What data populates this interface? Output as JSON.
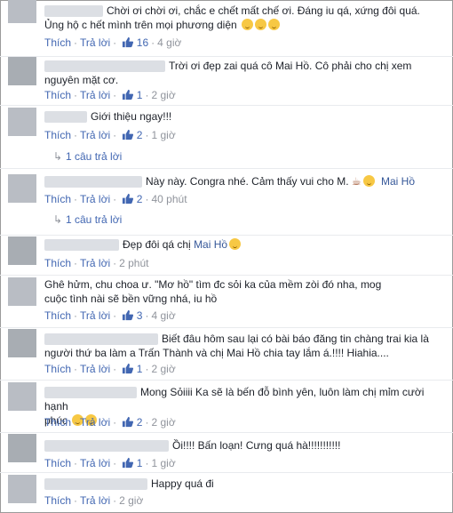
{
  "actions": {
    "like": "Thích",
    "reply": "Trả lời"
  },
  "comments": [
    {
      "line1": "Chời ơi chời ơi, chắc e chết mất chế ơi. Đáng iu qá, xứng đôi quá.",
      "line2": "Ủng hộ c hết mình trên mọi phương diện",
      "likes": "16",
      "time": "4 giờ"
    },
    {
      "line1": "Trời ơi đẹp zai quá cô Mai Hồ. Cô phải cho chị xem",
      "line2": "nguyên mặt cơ.",
      "likes": "1",
      "time": "2 giờ"
    },
    {
      "line1": "Giới thiệu ngay!!!",
      "likes": "2",
      "time": "1 giờ",
      "replies": "1 câu trả lời"
    },
    {
      "line1": "Này này. Congra nhé. Cảm thấy vui cho M.",
      "tag": "Mai Hồ",
      "likes": "2",
      "time": "40 phút",
      "replies": "1 câu trả lời"
    },
    {
      "line1": "Đẹp đôi qá chị",
      "tag": "Mai Hồ",
      "time": "2 phút"
    },
    {
      "line1": "Ghê hửm, chu choa ư. \"Mơ hồ\" tìm đc sỏi ka của mềm zòi đó nha, mog",
      "line2": "cuộc tình nài sẽ bền vững nhá, iu hồ",
      "likes": "3",
      "time": "4 giờ"
    },
    {
      "line1": "Biết đâu hôm sau lại có bài báo đăng tin chàng trai kia là",
      "line2": "người thứ ba làm a Trấn Thành và chị Mai Hồ chia tay lắm á.!!!! Hiahia....",
      "likes": "1",
      "time": "2 giờ"
    },
    {
      "line1": "Mong Sỏiiii Ka sẽ là bến đỗ bình yên, luôn làm chị mỉm cười hạnh",
      "line2": "phúc",
      "likes": "2",
      "time": "2 giờ"
    },
    {
      "line1": "Ồi!!!! Bấn loạn! Cưng quá hà!!!!!!!!!!!",
      "likes": "1",
      "time": "1 giờ"
    },
    {
      "line1": "Happy quá đi",
      "time": "2 giờ"
    }
  ],
  "colors": {
    "link": "#4267b2",
    "meta": "#90949c",
    "text": "#1d2129"
  }
}
